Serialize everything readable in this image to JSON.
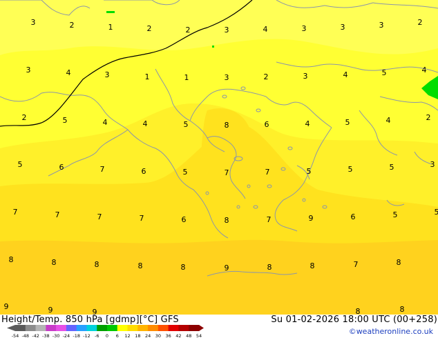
{
  "map": {
    "contour_labels": [
      [
        "3",
        48,
        36
      ],
      [
        "2",
        104,
        40
      ],
      [
        "1",
        160,
        43
      ],
      [
        "2",
        216,
        45
      ],
      [
        "2",
        272,
        47
      ],
      [
        "3",
        328,
        47
      ],
      [
        "4",
        384,
        46
      ],
      [
        "3",
        440,
        45
      ],
      [
        "3",
        496,
        43
      ],
      [
        "3",
        552,
        40
      ],
      [
        "2",
        608,
        36
      ],
      [
        "3",
        41,
        105
      ],
      [
        "4",
        99,
        109
      ],
      [
        "3",
        155,
        112
      ],
      [
        "1",
        213,
        115
      ],
      [
        "1",
        270,
        116
      ],
      [
        "3",
        328,
        116
      ],
      [
        "2",
        385,
        115
      ],
      [
        "3",
        442,
        114
      ],
      [
        "4",
        500,
        112
      ],
      [
        "5",
        556,
        109
      ],
      [
        "4",
        614,
        105
      ],
      [
        "2",
        35,
        174
      ],
      [
        "5",
        94,
        178
      ],
      [
        "4",
        152,
        181
      ],
      [
        "4",
        210,
        183
      ],
      [
        "5",
        269,
        184
      ],
      [
        "8",
        328,
        185
      ],
      [
        "6",
        386,
        184
      ],
      [
        "4",
        445,
        183
      ],
      [
        "5",
        503,
        181
      ],
      [
        "4",
        562,
        178
      ],
      [
        "2",
        620,
        174
      ],
      [
        "5",
        29,
        242
      ],
      [
        "6",
        89,
        246
      ],
      [
        "7",
        148,
        249
      ],
      [
        "6",
        208,
        252
      ],
      [
        "5",
        268,
        253
      ],
      [
        "7",
        328,
        254
      ],
      [
        "7",
        387,
        253
      ],
      [
        "5",
        447,
        252
      ],
      [
        "5",
        507,
        249
      ],
      [
        "5",
        567,
        246
      ],
      [
        "3",
        626,
        242
      ],
      [
        "7",
        22,
        311
      ],
      [
        "7",
        83,
        315
      ],
      [
        "7",
        144,
        318
      ],
      [
        "7",
        205,
        320
      ],
      [
        "6",
        266,
        322
      ],
      [
        "8",
        328,
        323
      ],
      [
        "7",
        389,
        322
      ],
      [
        "9",
        450,
        320
      ],
      [
        "6",
        511,
        318
      ],
      [
        "5",
        572,
        315
      ],
      [
        "5",
        632,
        311
      ],
      [
        "8",
        16,
        380
      ],
      [
        "8",
        78,
        384
      ],
      [
        "8",
        140,
        387
      ],
      [
        "8",
        203,
        389
      ],
      [
        "8",
        265,
        391
      ],
      [
        "9",
        328,
        392
      ],
      [
        "8",
        390,
        391
      ],
      [
        "8",
        452,
        389
      ],
      [
        "7",
        515,
        387
      ],
      [
        "8",
        577,
        384
      ],
      [
        "9",
        9,
        448
      ],
      [
        "9",
        73,
        453
      ],
      [
        "9",
        137,
        456
      ],
      [
        "8",
        518,
        455
      ],
      [
        "8",
        582,
        452
      ]
    ],
    "colors": {
      "yellow": "#ffff33",
      "yellow_light": "#ffff55",
      "yellow_orange": "#fff02a",
      "orange_light": "#ffe21e",
      "orange": "#ffd21e",
      "green": "#00dd00",
      "coast": "#8c96a8",
      "border": "#000000"
    }
  },
  "footer": {
    "title": "Height/Temp. 850 hPa [gdmp][°C] GFS",
    "valid_time": "Su 01-02-2026 18:00 UTC (00+258)",
    "credit": "©weatheronline.co.uk",
    "colorbar": {
      "ticks": [
        "-54",
        "-48",
        "-42",
        "-38",
        "-30",
        "-24",
        "-18",
        "-12",
        "-6",
        "0",
        "6",
        "12",
        "18",
        "24",
        "30",
        "36",
        "42",
        "48",
        "54"
      ],
      "colors": [
        "#5a5a5a",
        "#8c8c8c",
        "#b4b4b4",
        "#c83cc8",
        "#e650e6",
        "#6464ff",
        "#28a0ff",
        "#00d2dc",
        "#00a000",
        "#00c800",
        "#ffff00",
        "#ffdc00",
        "#ffb400",
        "#ff8c00",
        "#ff5000",
        "#e10000",
        "#b40000",
        "#8c0000"
      ]
    }
  }
}
